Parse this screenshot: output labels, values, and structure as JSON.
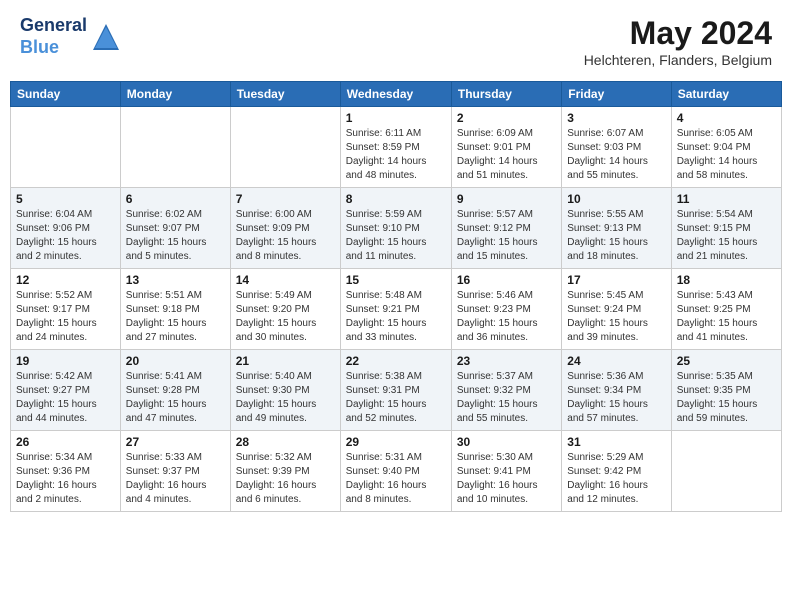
{
  "header": {
    "logo_line1": "General",
    "logo_line2": "Blue",
    "main_title": "May 2024",
    "subtitle": "Helchteren, Flanders, Belgium"
  },
  "weekdays": [
    "Sunday",
    "Monday",
    "Tuesday",
    "Wednesday",
    "Thursday",
    "Friday",
    "Saturday"
  ],
  "weeks": [
    [
      {
        "day": "",
        "info": ""
      },
      {
        "day": "",
        "info": ""
      },
      {
        "day": "",
        "info": ""
      },
      {
        "day": "1",
        "info": "Sunrise: 6:11 AM\nSunset: 8:59 PM\nDaylight: 14 hours\nand 48 minutes."
      },
      {
        "day": "2",
        "info": "Sunrise: 6:09 AM\nSunset: 9:01 PM\nDaylight: 14 hours\nand 51 minutes."
      },
      {
        "day": "3",
        "info": "Sunrise: 6:07 AM\nSunset: 9:03 PM\nDaylight: 14 hours\nand 55 minutes."
      },
      {
        "day": "4",
        "info": "Sunrise: 6:05 AM\nSunset: 9:04 PM\nDaylight: 14 hours\nand 58 minutes."
      }
    ],
    [
      {
        "day": "5",
        "info": "Sunrise: 6:04 AM\nSunset: 9:06 PM\nDaylight: 15 hours\nand 2 minutes."
      },
      {
        "day": "6",
        "info": "Sunrise: 6:02 AM\nSunset: 9:07 PM\nDaylight: 15 hours\nand 5 minutes."
      },
      {
        "day": "7",
        "info": "Sunrise: 6:00 AM\nSunset: 9:09 PM\nDaylight: 15 hours\nand 8 minutes."
      },
      {
        "day": "8",
        "info": "Sunrise: 5:59 AM\nSunset: 9:10 PM\nDaylight: 15 hours\nand 11 minutes."
      },
      {
        "day": "9",
        "info": "Sunrise: 5:57 AM\nSunset: 9:12 PM\nDaylight: 15 hours\nand 15 minutes."
      },
      {
        "day": "10",
        "info": "Sunrise: 5:55 AM\nSunset: 9:13 PM\nDaylight: 15 hours\nand 18 minutes."
      },
      {
        "day": "11",
        "info": "Sunrise: 5:54 AM\nSunset: 9:15 PM\nDaylight: 15 hours\nand 21 minutes."
      }
    ],
    [
      {
        "day": "12",
        "info": "Sunrise: 5:52 AM\nSunset: 9:17 PM\nDaylight: 15 hours\nand 24 minutes."
      },
      {
        "day": "13",
        "info": "Sunrise: 5:51 AM\nSunset: 9:18 PM\nDaylight: 15 hours\nand 27 minutes."
      },
      {
        "day": "14",
        "info": "Sunrise: 5:49 AM\nSunset: 9:20 PM\nDaylight: 15 hours\nand 30 minutes."
      },
      {
        "day": "15",
        "info": "Sunrise: 5:48 AM\nSunset: 9:21 PM\nDaylight: 15 hours\nand 33 minutes."
      },
      {
        "day": "16",
        "info": "Sunrise: 5:46 AM\nSunset: 9:23 PM\nDaylight: 15 hours\nand 36 minutes."
      },
      {
        "day": "17",
        "info": "Sunrise: 5:45 AM\nSunset: 9:24 PM\nDaylight: 15 hours\nand 39 minutes."
      },
      {
        "day": "18",
        "info": "Sunrise: 5:43 AM\nSunset: 9:25 PM\nDaylight: 15 hours\nand 41 minutes."
      }
    ],
    [
      {
        "day": "19",
        "info": "Sunrise: 5:42 AM\nSunset: 9:27 PM\nDaylight: 15 hours\nand 44 minutes."
      },
      {
        "day": "20",
        "info": "Sunrise: 5:41 AM\nSunset: 9:28 PM\nDaylight: 15 hours\nand 47 minutes."
      },
      {
        "day": "21",
        "info": "Sunrise: 5:40 AM\nSunset: 9:30 PM\nDaylight: 15 hours\nand 49 minutes."
      },
      {
        "day": "22",
        "info": "Sunrise: 5:38 AM\nSunset: 9:31 PM\nDaylight: 15 hours\nand 52 minutes."
      },
      {
        "day": "23",
        "info": "Sunrise: 5:37 AM\nSunset: 9:32 PM\nDaylight: 15 hours\nand 55 minutes."
      },
      {
        "day": "24",
        "info": "Sunrise: 5:36 AM\nSunset: 9:34 PM\nDaylight: 15 hours\nand 57 minutes."
      },
      {
        "day": "25",
        "info": "Sunrise: 5:35 AM\nSunset: 9:35 PM\nDaylight: 15 hours\nand 59 minutes."
      }
    ],
    [
      {
        "day": "26",
        "info": "Sunrise: 5:34 AM\nSunset: 9:36 PM\nDaylight: 16 hours\nand 2 minutes."
      },
      {
        "day": "27",
        "info": "Sunrise: 5:33 AM\nSunset: 9:37 PM\nDaylight: 16 hours\nand 4 minutes."
      },
      {
        "day": "28",
        "info": "Sunrise: 5:32 AM\nSunset: 9:39 PM\nDaylight: 16 hours\nand 6 minutes."
      },
      {
        "day": "29",
        "info": "Sunrise: 5:31 AM\nSunset: 9:40 PM\nDaylight: 16 hours\nand 8 minutes."
      },
      {
        "day": "30",
        "info": "Sunrise: 5:30 AM\nSunset: 9:41 PM\nDaylight: 16 hours\nand 10 minutes."
      },
      {
        "day": "31",
        "info": "Sunrise: 5:29 AM\nSunset: 9:42 PM\nDaylight: 16 hours\nand 12 minutes."
      },
      {
        "day": "",
        "info": ""
      }
    ]
  ]
}
